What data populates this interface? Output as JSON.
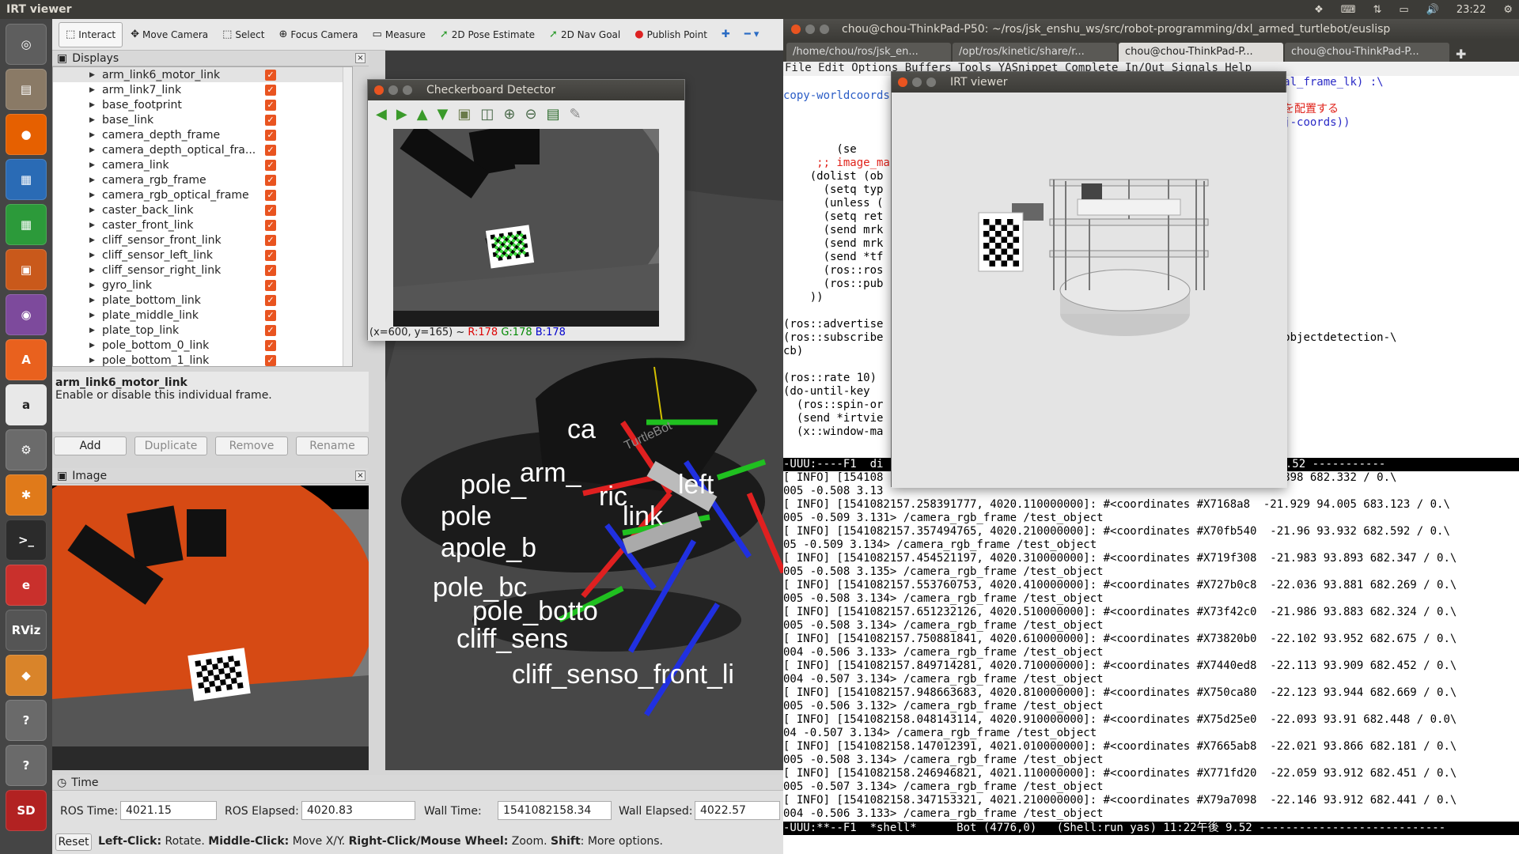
{
  "topbar": {
    "title": "IRT viewer",
    "time": "23:22"
  },
  "launcher": {
    "items": [
      "dash",
      "files",
      "firefox",
      "writer",
      "calc",
      "impress",
      "screenshot",
      "software",
      "amazon",
      "settings",
      "updater",
      "terminal",
      "emacs",
      "rviz",
      "virtualbox",
      "help",
      "help2",
      "card"
    ],
    "rviz_label": "RViz"
  },
  "rviz": {
    "tools": [
      {
        "label": "Interact",
        "icon": "cursor-icon"
      },
      {
        "label": "Move Camera",
        "icon": "move-icon"
      },
      {
        "label": "Select",
        "icon": "select-icon"
      },
      {
        "label": "Focus Camera",
        "icon": "focus-icon"
      },
      {
        "label": "Measure",
        "icon": "ruler-icon"
      },
      {
        "label": "2D Pose Estimate",
        "icon": "arrow-green-icon"
      },
      {
        "label": "2D Nav Goal",
        "icon": "arrow-green-icon"
      },
      {
        "label": "Publish Point",
        "icon": "pin-icon"
      }
    ],
    "displays_title": "Displays",
    "frames": [
      "arm_link6_motor_link",
      "arm_link7_link",
      "base_footprint",
      "base_link",
      "camera_depth_frame",
      "camera_depth_optical_fra...",
      "camera_link",
      "camera_rgb_frame",
      "camera_rgb_optical_frame",
      "caster_back_link",
      "caster_front_link",
      "cliff_sensor_front_link",
      "cliff_sensor_left_link",
      "cliff_sensor_right_link",
      "gyro_link",
      "plate_bottom_link",
      "plate_middle_link",
      "plate_top_link",
      "pole_bottom_0_link",
      "pole_bottom_1_link"
    ],
    "desc_title": "arm_link6_motor_link",
    "desc_text": "Enable or disable this individual frame.",
    "buttons": [
      "Add",
      "Duplicate",
      "Remove",
      "Rename"
    ],
    "image_title": "Image",
    "view_labels": [
      "ca",
      "pole_",
      "arm_",
      "pole",
      "apole_b",
      "pole_bc",
      "cliff_sens",
      "pole_botto",
      "cliff_senso_front_li",
      "ric",
      "link",
      "left"
    ],
    "time_title": "Time",
    "ros_time_label": "ROS Time:",
    "ros_time": "4021.15",
    "ros_elapsed_label": "ROS Elapsed:",
    "ros_elapsed": "4020.83",
    "wall_time_label": "Wall Time:",
    "wall_time": "1541082158.34",
    "wall_elapsed_label": "Wall Elapsed:",
    "wall_elapsed": "4022.57",
    "reset": "Reset",
    "status": [
      [
        "Left-Click:",
        " Rotate. "
      ],
      [
        "Middle-Click:",
        " Move X/Y. "
      ],
      [
        "Right-Click/Mouse Wheel:",
        ":"
      ],
      [
        " Zoom. ",
        ""
      ],
      [
        "Shift",
        ": More options."
      ]
    ]
  },
  "checkerboard": {
    "title": "Checkerboard Detector",
    "coord": "(x=600, y=165) ~",
    "r": "R:178",
    "g": "G:178",
    "b": "B:178"
  },
  "terminal": {
    "title": "chou@chou-ThinkPad-P50: ~/ros/jsk_enshu_ws/src/robot-programming/dxl_armed_turtlebot/euslisp",
    "tabs": [
      "/home/chou/ros/jsk_en...",
      "/opt/ros/kinetic/share/r...",
      "chou@chou-ThinkPad-P...",
      "chou@chou-ThinkPad-P..."
    ],
    "menu": "File Edit Options Buffers Tools YASnippet Complete In/Out Signals Help",
    "code_lines": [
      "                                                           camera_rgb_optical_frame_lk) :\\",
      "copy-worldcoords",
      "                                                           heckerboardモデルを配置する",
      "                                                           ransform cam->obj-coords))",
      "",
      "        (se",
      "     ;; image_ma",
      "    (dolist (ob",
      "      (setq typ",
      "      (unless (                                              type)))",
      "      (setq ret",
      "      (send mrk",
      "      (send mrk",
      "      (send *tf",
      "      (ros::ros",
      "      (ros::pub",
      "    ))",
      "",
      "(ros::advertise",
      "(ros::subscribe                                              ctDetection #'objectdetection-\\",
      "cb)",
      "",
      "(ros::rate 10)",
      "(do-until-key",
      "  (ros::spin-or",
      "  (send *irtvie",
      "  (x::window-ma"
    ],
    "modeline1": "-UUU:----F1  di                                             yas) 11:22午後 9.52 -----------",
    "log_lines": [
      "[ INFO] [154108                                              8  -21.876 93.898 682.332 / 0.\\",
      "005 -0.508 3.13",
      "[ INFO] [1541082157.258391777, 4020.110000000]: #<coordinates #X7168a8  -21.929 94.005 683.123 / 0.\\",
      "005 -0.509 3.131> /camera_rgb_frame /test_object",
      "[ INFO] [1541082157.357494765, 4020.210000000]: #<coordinates #X70fb540  -21.96 93.932 682.592 / 0.\\",
      "05 -0.509 3.134> /camera_rgb_frame /test_object",
      "[ INFO] [1541082157.454521197, 4020.310000000]: #<coordinates #X719f308  -21.983 93.893 682.347 / 0.\\",
      "005 -0.508 3.135> /camera_rgb_frame /test_object",
      "[ INFO] [1541082157.553760753, 4020.410000000]: #<coordinates #X727b0c8  -22.036 93.881 682.269 / 0.\\",
      "005 -0.508 3.134> /camera_rgb_frame /test_object",
      "[ INFO] [1541082157.651232126, 4020.510000000]: #<coordinates #X73f42c0  -21.986 93.883 682.324 / 0.\\",
      "005 -0.508 3.134> /camera_rgb_frame /test_object",
      "[ INFO] [1541082157.750881841, 4020.610000000]: #<coordinates #X73820b0  -22.102 93.952 682.675 / 0.\\",
      "004 -0.506 3.133> /camera_rgb_frame /test_object",
      "[ INFO] [1541082157.849714281, 4020.710000000]: #<coordinates #X7440ed8  -22.113 93.909 682.452 / 0.\\",
      "004 -0.507 3.134> /camera_rgb_frame /test_object",
      "[ INFO] [1541082157.948663683, 4020.810000000]: #<coordinates #X750ca80  -22.123 93.944 682.669 / 0.\\",
      "005 -0.506 3.132> /camera_rgb_frame /test_object",
      "[ INFO] [1541082158.048143114, 4020.910000000]: #<coordinates #X75d25e0  -22.093 93.91 682.448 / 0.0\\",
      "04 -0.507 3.134> /camera_rgb_frame /test_object",
      "[ INFO] [1541082158.147012391, 4021.010000000]: #<coordinates #X7665ab8  -22.021 93.866 682.181 / 0.\\",
      "005 -0.508 3.134> /camera_rgb_frame /test_object",
      "[ INFO] [1541082158.246946821, 4021.110000000]: #<coordinates #X771fd20  -22.059 93.912 682.451 / 0.\\",
      "005 -0.507 3.134> /camera_rgb_frame /test_object",
      "[ INFO] [1541082158.347153321, 4021.210000000]: #<coordinates #X79a7098  -22.146 93.912 682.441 / 0.\\",
      "004 -0.506 3.133> /camera_rgb_frame /test_object"
    ],
    "modeline2": "-UUU:**--F1  *shell*      Bot (4776,0)   (Shell:run yas) 11:22午後 9.52 ----------------------------"
  },
  "irt": {
    "title": "IRT viewer"
  }
}
